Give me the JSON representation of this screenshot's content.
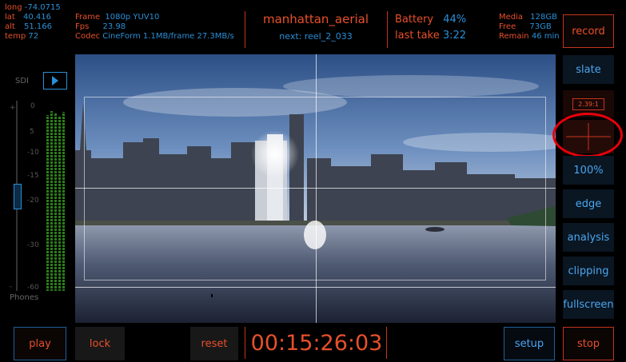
{
  "telemetry": {
    "long_label": "long",
    "long_value": "-74.0715",
    "lat_label": "lat",
    "lat_value": "40.416",
    "alt_label": "alt",
    "alt_value": "51.166",
    "temp_label": "temp",
    "temp_value": "72"
  },
  "format": {
    "frame_label": "Frame",
    "frame_value": "1080p YUV10",
    "fps_label": "Fps",
    "fps_value": "23.98",
    "codec_label": "Codec",
    "codec_value": "CineForm 1.1MB/frame 27.3MB/s"
  },
  "clip": {
    "name": "manhattan_aerial",
    "next": "next: reel_2_033"
  },
  "status": {
    "battery_label": "Battery",
    "battery_value": "44%",
    "last_take_label": "last take",
    "last_take_value": "3:22"
  },
  "storage": {
    "media_label": "Media",
    "media_value": "128GB",
    "free_label": "Free",
    "free_value": "73GB",
    "remain_label": "Remain",
    "remain_value": "46 min"
  },
  "buttons": {
    "record": "record",
    "slate": "slate",
    "aspect": "2.39:1",
    "zoom": "100%",
    "edge": "edge",
    "analysis": "analysis",
    "clipping": "clipping",
    "fullscreen": "fullscreen",
    "play": "play",
    "lock": "lock",
    "reset": "reset",
    "setup": "setup",
    "stop": "stop"
  },
  "audio": {
    "source_label": "SDI",
    "phones_label": "Phones",
    "scale": [
      "0",
      "5",
      "-10",
      "-15",
      "-20",
      "-30",
      "-60"
    ],
    "plus": "+",
    "minus": "-"
  },
  "timecode": "00:15:26:03",
  "colors": {
    "accent": "#e8502a",
    "border": "#c5331c",
    "blue": "#2a8fd6",
    "meter": "#2b7f18"
  }
}
